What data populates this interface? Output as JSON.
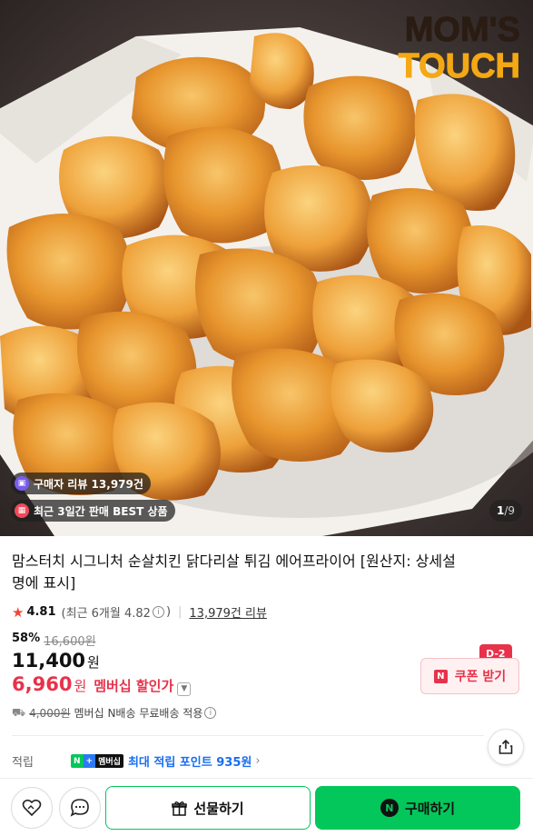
{
  "hero": {
    "logo_line1": "MOM'S",
    "logo_line2": "TOUCH",
    "badge_reviews": "구매자 리뷰 13,979건",
    "badge_best": "최근 3일간 판매 BEST 상품",
    "slide_current": "1",
    "slide_total": "/9"
  },
  "product": {
    "title": "맘스터치 시그니처 순살치킨 닭다리살 튀김 에어프라이어 [원산지: 상세설명에 표시]",
    "rating": "4.81",
    "rating_recent": "(최근 6개월 4.82",
    "rating_recent_close": ")",
    "review_count": "13,979건 리뷰",
    "discount_pct": "58%",
    "original_price": "16,600원",
    "price": "11,400",
    "price_unit": "원",
    "member_price": "6,960",
    "member_price_unit": "원",
    "member_label": "멤버십 할인가",
    "shipping_original": "4,000원",
    "shipping_text": "멤버십 N배송 무료배송 적용"
  },
  "coupon": {
    "label": "쿠폰 받기",
    "n_mark": "N",
    "dday": "D-2"
  },
  "points": {
    "label": "적립",
    "badge_n": "N",
    "badge_plus": "+",
    "badge_member": "멤버십",
    "text": "최대 적립 포인트 935원"
  },
  "bottom": {
    "gift_label": "선물하기",
    "buy_label": "구매하기",
    "buy_logo": "N"
  },
  "colors": {
    "naver_green": "#03c75a",
    "accent_red": "#e8324a",
    "points_blue": "#1a6ef0"
  }
}
